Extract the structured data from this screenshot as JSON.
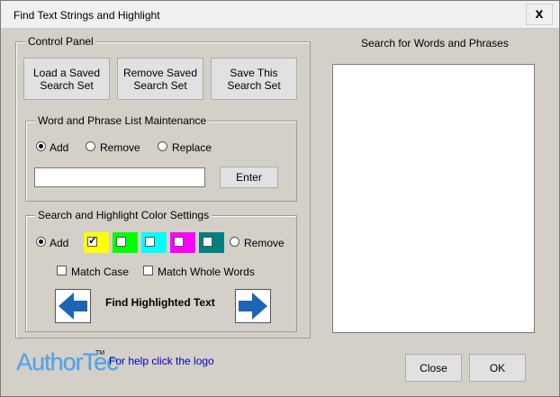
{
  "window": {
    "title": "Find Text Strings and Highlight",
    "close_label": "x"
  },
  "control_panel": {
    "legend": "Control Panel",
    "buttons": [
      {
        "line1": "Load a Saved",
        "line2": "Search Set"
      },
      {
        "line1": "Remove Saved",
        "line2": "Search Set"
      },
      {
        "line1": "Save This",
        "line2": "Search Set"
      }
    ]
  },
  "maintenance": {
    "legend": "Word and Phrase List Maintenance",
    "add": "Add",
    "remove": "Remove",
    "replace": "Replace",
    "selected": "Add",
    "input_value": "",
    "enter": "Enter"
  },
  "color_settings": {
    "legend": "Search and Highlight Color Settings",
    "add": "Add",
    "remove": "Remove",
    "selected": "Add",
    "swatches": [
      {
        "color": "#ffff00",
        "checked": true
      },
      {
        "color": "#00ff00",
        "checked": false
      },
      {
        "color": "#00ffff",
        "checked": false
      },
      {
        "color": "#ff00ff",
        "checked": false
      },
      {
        "color": "#008080",
        "checked": false
      }
    ],
    "match_case": "Match Case",
    "match_whole": "Match Whole Words",
    "find_label": "Find Highlighted Text",
    "arrow_color": "#1e64b4"
  },
  "search_panel": {
    "title": "Search for Words and Phrases"
  },
  "footer": {
    "logo_text": "AuthorTec",
    "tm": "TM",
    "help": "For help click the logo",
    "close": "Close",
    "ok": "OK"
  }
}
